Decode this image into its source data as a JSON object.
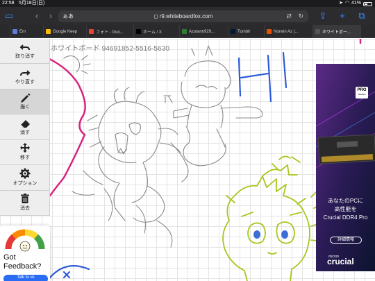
{
  "status_bar": {
    "time": "22:58",
    "date": "5月18日(日)",
    "battery": "41%",
    "battery_level": 0.41
  },
  "browser": {
    "reader_label": "ぁあ",
    "url": "r9.whiteboardfox.com",
    "tabs": [
      {
        "label": "Em",
        "icon": "generic-favicon",
        "color": "#5b7bd5"
      },
      {
        "label": "Google Keep",
        "icon": "keep-favicon",
        "color": "#fbbc04"
      },
      {
        "label": "フォト - Goo...",
        "icon": "photos-favicon",
        "color": "#ea4335"
      },
      {
        "label": "ホーム / X",
        "icon": "x-favicon",
        "color": "#000000"
      },
      {
        "label": "Azutann929...",
        "icon": "azutann-favicon",
        "color": "#2e7d32"
      },
      {
        "label": "Tumblr",
        "icon": "tumblr-favicon",
        "color": "#001935"
      },
      {
        "label": "Norwin Az (...",
        "icon": "norwin-favicon",
        "color": "#e65100"
      },
      {
        "label": "ホワイトボー...",
        "icon": "whiteboard-favicon",
        "color": "#555555",
        "active": true
      }
    ]
  },
  "board": {
    "title": "ホワイトボード 94691852-5516-5630"
  },
  "tools": [
    {
      "label": "取り消す",
      "icon": "undo-icon"
    },
    {
      "label": "やり直す",
      "icon": "redo-icon"
    },
    {
      "label": "描く",
      "icon": "pencil-icon",
      "selected": true
    },
    {
      "label": "消す",
      "icon": "eraser-icon"
    },
    {
      "label": "移す",
      "icon": "move-icon"
    },
    {
      "label": "オプション",
      "icon": "gear-icon"
    },
    {
      "label": "消去",
      "icon": "trash-icon"
    }
  ],
  "feedback": {
    "text": "Got Feedback?",
    "button": "Talk to us"
  },
  "ad": {
    "badge": "PRO",
    "badge_sub": "SERIES",
    "line1": "あなたのPCに",
    "line2": "高性能を",
    "line3": "Crucial DDR4 Pro",
    "button": "詳細情報",
    "brand_sub": "micron",
    "brand": "crucial"
  },
  "colors": {
    "pink_stroke": "#d6247e",
    "blue_stroke": "#2d5bd8",
    "green_stroke": "#a6c71d",
    "gray_stroke": "#8a8a8a"
  }
}
